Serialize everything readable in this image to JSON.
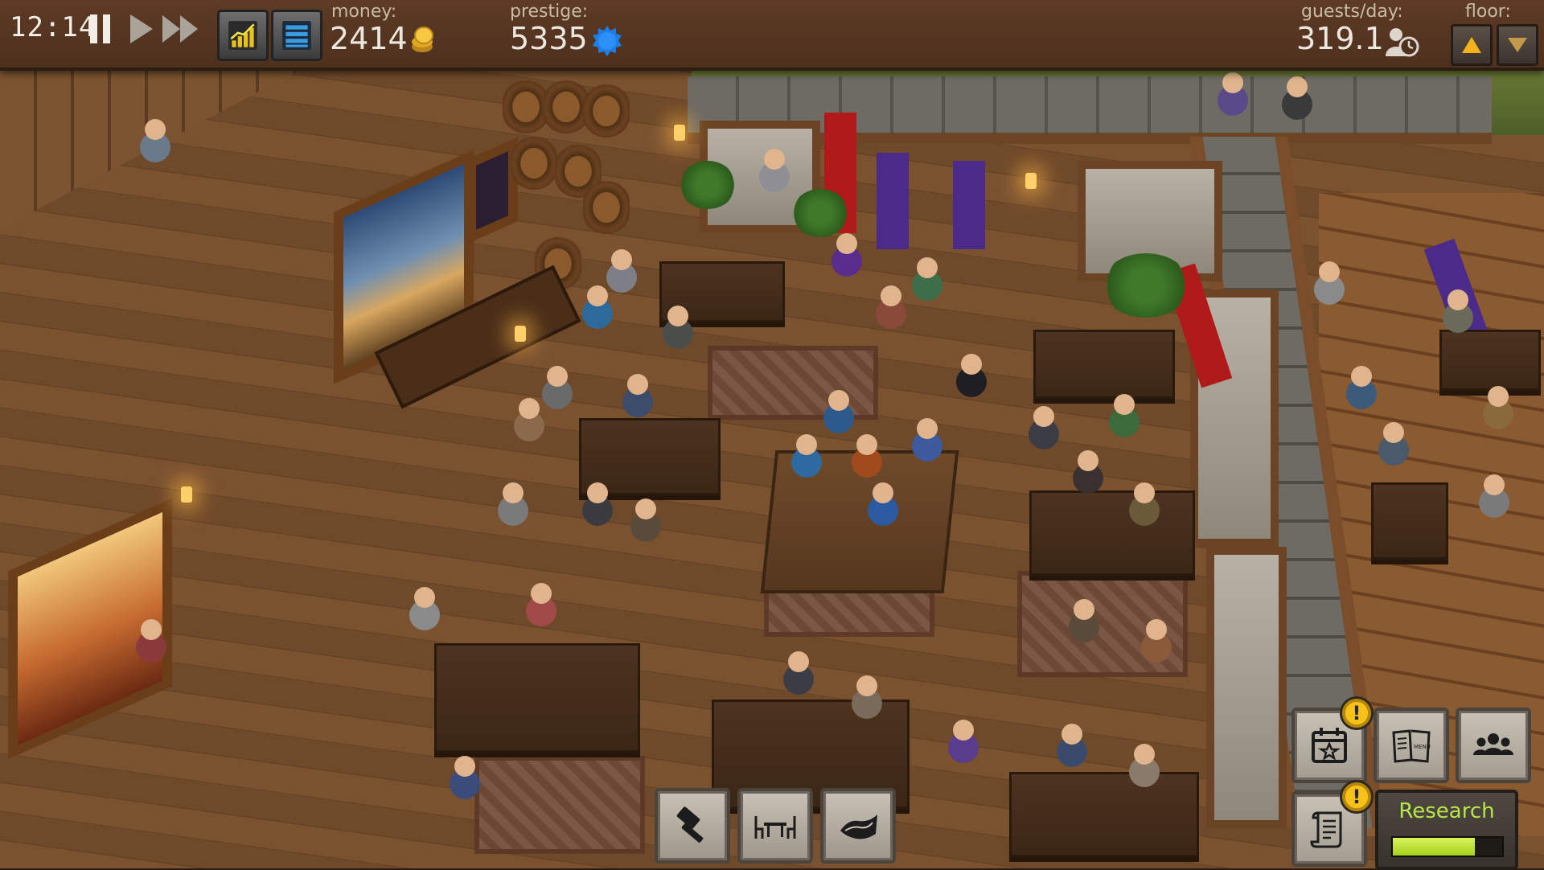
{
  "hud": {
    "clock": "12:14",
    "money_label": "money:",
    "money_value": "2414",
    "prestige_label": "prestige:",
    "prestige_value": "5335",
    "guests_label": "guests/day:",
    "guests_value": "319.1",
    "floor_label": "floor:"
  },
  "toolbar": {
    "build": "hammer-icon",
    "furniture": "table-chairs-icon",
    "floor": "carpet-icon"
  },
  "panel": {
    "events_alert": "!",
    "menu_book_text": "MENU",
    "quests_alert": "!",
    "research_label": "Research",
    "research_progress": 0.75
  },
  "colors": {
    "hud_bg": "#5e3b25",
    "research_accent": "#b8e64a",
    "alert": "#f6c21a",
    "floor_up": "#f2b21c"
  }
}
